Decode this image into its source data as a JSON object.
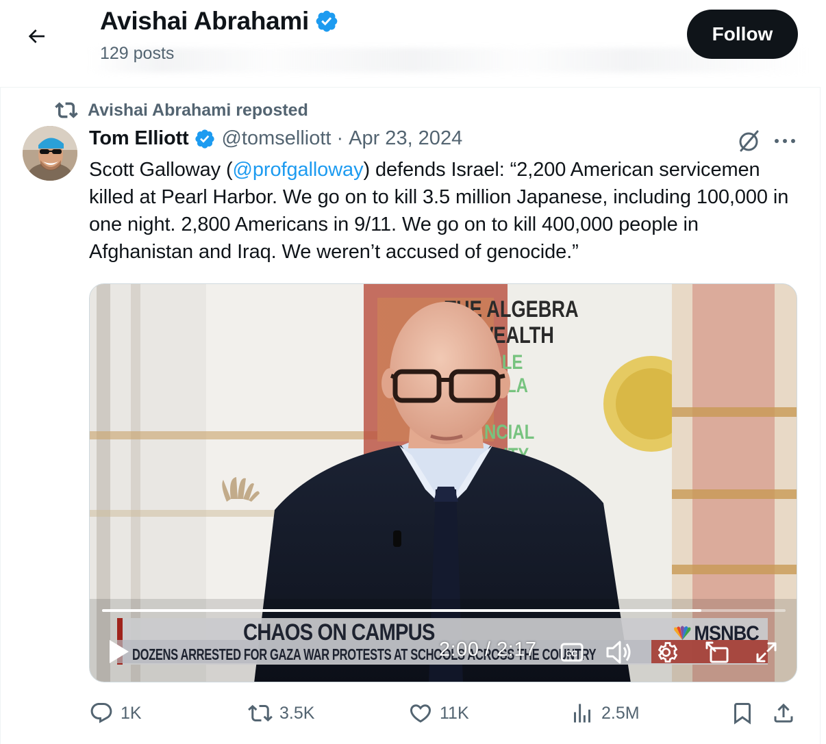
{
  "header": {
    "name": "Avishai Abrahami",
    "posts_count": "129 posts",
    "follow_label": "Follow"
  },
  "repost": {
    "text": "Avishai Abrahami reposted"
  },
  "tweet": {
    "author_name": "Tom Elliott",
    "handle": "@tomselliott",
    "separator": "·",
    "date": "Apr 23, 2024",
    "text_before": "Scott Galloway (",
    "mention": "@profgalloway",
    "text_after": ") defends Israel: “2,200 American servicemen killed at Pearl Harbor. We go on to kill 3.5 million Japanese, including 100,000 in one night. 2,800 Americans in 9/11. We go on to kill 400,000 people in Afghanistan and Iraq. We weren’t accused of genocide.”"
  },
  "video": {
    "chyron_title": "CHAOS ON CAMPUS",
    "chyron_sub": "DOZENS ARRESTED FOR GAZA WAR PROTESTS AT SCHOOLS ACROSS THE COUNTRY",
    "network": "MSNBC",
    "time": "2:00 / 2:17",
    "progress": 0.877,
    "book_title": "THE ALGEBRA OF WEALTH",
    "book_sub": "A SIMPLE FORMULA FOR FINANCIAL SECURITY"
  },
  "actions": {
    "replies": "1K",
    "reposts": "3.5K",
    "likes": "11K",
    "views": "2.5M"
  },
  "colors": {
    "accent": "#1d9bf0",
    "text": "#0f1419",
    "muted": "#536471"
  }
}
